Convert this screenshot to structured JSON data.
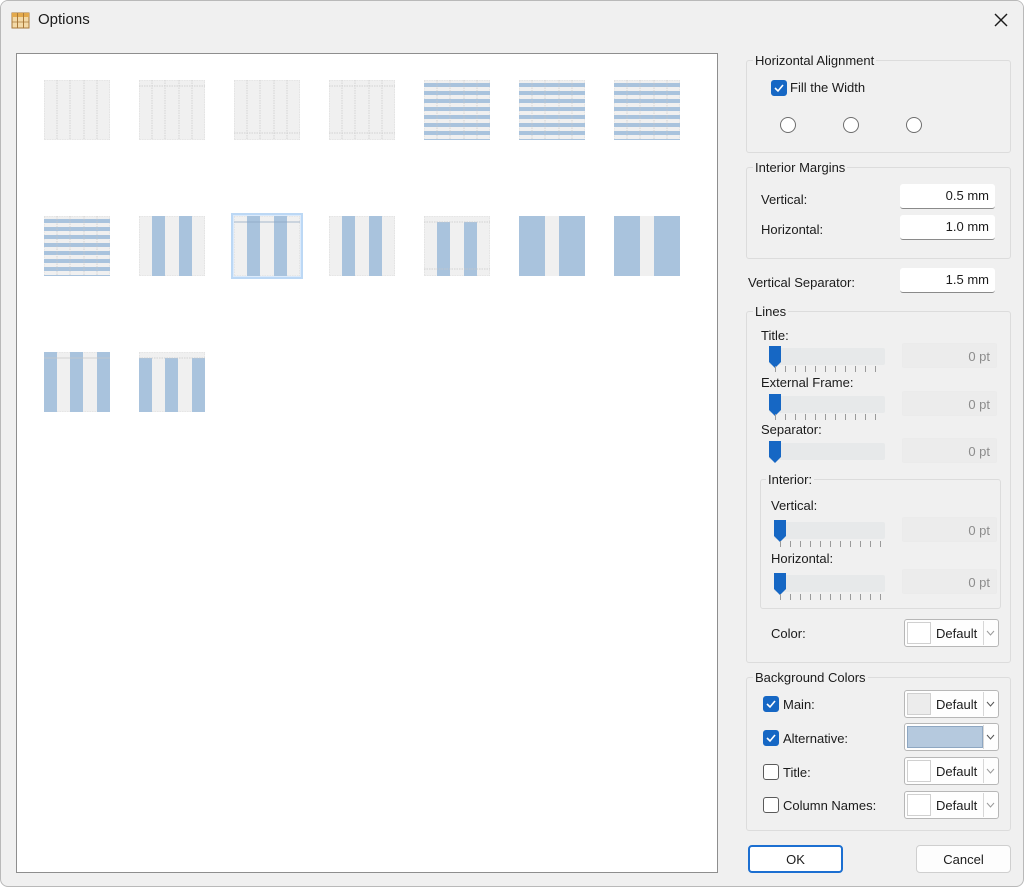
{
  "window": {
    "title": "Options"
  },
  "horizontal_alignment": {
    "label": "Horizontal Alignment",
    "fill_width": {
      "label": "Fill the Width",
      "checked": true
    }
  },
  "interior_margins": {
    "label": "Interior Margins",
    "vertical": {
      "label": "Vertical:",
      "value": "0.5 mm"
    },
    "horizontal": {
      "label": "Horizontal:",
      "value": "1.0 mm"
    }
  },
  "vertical_separator": {
    "label": "Vertical Separator:",
    "value": "1.5 mm"
  },
  "lines": {
    "label": "Lines",
    "title": {
      "label": "Title:",
      "value": "0 pt"
    },
    "external_frame": {
      "label": "External Frame:",
      "value": "0 pt"
    },
    "separator": {
      "label": "Separator:",
      "value": "0 pt"
    },
    "interior": {
      "label": "Interior:",
      "vertical": {
        "label": "Vertical:",
        "value": "0 pt"
      },
      "horizontal": {
        "label": "Horizontal:",
        "value": "0 pt"
      }
    },
    "color": {
      "label": "Color:",
      "value": "Default"
    }
  },
  "background_colors": {
    "label": "Background Colors",
    "main": {
      "label": "Main:",
      "checked": true,
      "value": "Default"
    },
    "alternative": {
      "label": "Alternative:",
      "checked": true,
      "color": "#b5c9de"
    },
    "title": {
      "label": "Title:",
      "checked": false,
      "value": "Default"
    },
    "column_names": {
      "label": "Column Names:",
      "checked": false,
      "value": "Default"
    }
  },
  "buttons": {
    "ok": "OK",
    "cancel": "Cancel"
  },
  "colors": {
    "accent": "#1667c4",
    "style_blue": "#a9c3dd",
    "style_grid": "#c8c8c8",
    "selected_style_bg": "#dbeafb"
  },
  "table_styles": [
    {
      "kind": "plain-grid",
      "selected": false
    },
    {
      "kind": "plain-grid-title",
      "selected": false
    },
    {
      "kind": "plain-grid-footer",
      "selected": false
    },
    {
      "kind": "plain-grid-title-footer",
      "selected": false
    },
    {
      "kind": "row-bands",
      "selected": false
    },
    {
      "kind": "row-bands",
      "selected": false
    },
    {
      "kind": "row-bands",
      "selected": false
    },
    {
      "kind": "row-bands",
      "selected": false
    },
    {
      "kind": "column-bands",
      "selected": false
    },
    {
      "kind": "column-bands",
      "selected": true
    },
    {
      "kind": "column-bands",
      "selected": false
    },
    {
      "kind": "column-bands-title",
      "selected": false
    },
    {
      "kind": "column-bands-solid",
      "selected": false
    },
    {
      "kind": "column-bands-solid",
      "selected": false
    },
    {
      "kind": "column-bands-full",
      "selected": false
    },
    {
      "kind": "column-bands-title-only",
      "selected": false
    }
  ]
}
